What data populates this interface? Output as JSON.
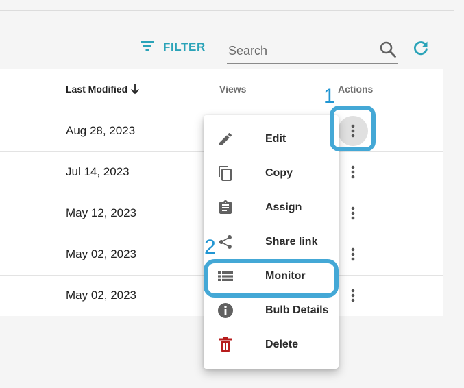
{
  "toolbar": {
    "filter_label": "FILTER",
    "search_placeholder": "Search"
  },
  "table": {
    "columns": {
      "last_modified": "Last Modified",
      "views": "Views",
      "actions": "Actions"
    },
    "rows": [
      {
        "last_modified": "Aug 28, 2023"
      },
      {
        "last_modified": "Jul 14, 2023"
      },
      {
        "last_modified": "May 12, 2023"
      },
      {
        "last_modified": "May 02, 2023"
      },
      {
        "last_modified": "May 02, 2023"
      }
    ]
  },
  "menu": {
    "items": [
      {
        "label": "Edit",
        "icon": "pencil-icon"
      },
      {
        "label": "Copy",
        "icon": "copy-icon"
      },
      {
        "label": "Assign",
        "icon": "clipboard-icon"
      },
      {
        "label": "Share link",
        "icon": "share-icon"
      },
      {
        "label": "Monitor",
        "icon": "list-icon"
      },
      {
        "label": "Bulb Details",
        "icon": "info-icon"
      },
      {
        "label": "Delete",
        "icon": "trash-icon"
      }
    ]
  },
  "annotations": {
    "step1": "1",
    "step2": "2"
  },
  "colors": {
    "accent": "#2aa3b8",
    "highlight": "#44a8d6",
    "step_number": "#2196d3",
    "delete_icon": "#b71c1c",
    "icon_gray": "#616161"
  }
}
